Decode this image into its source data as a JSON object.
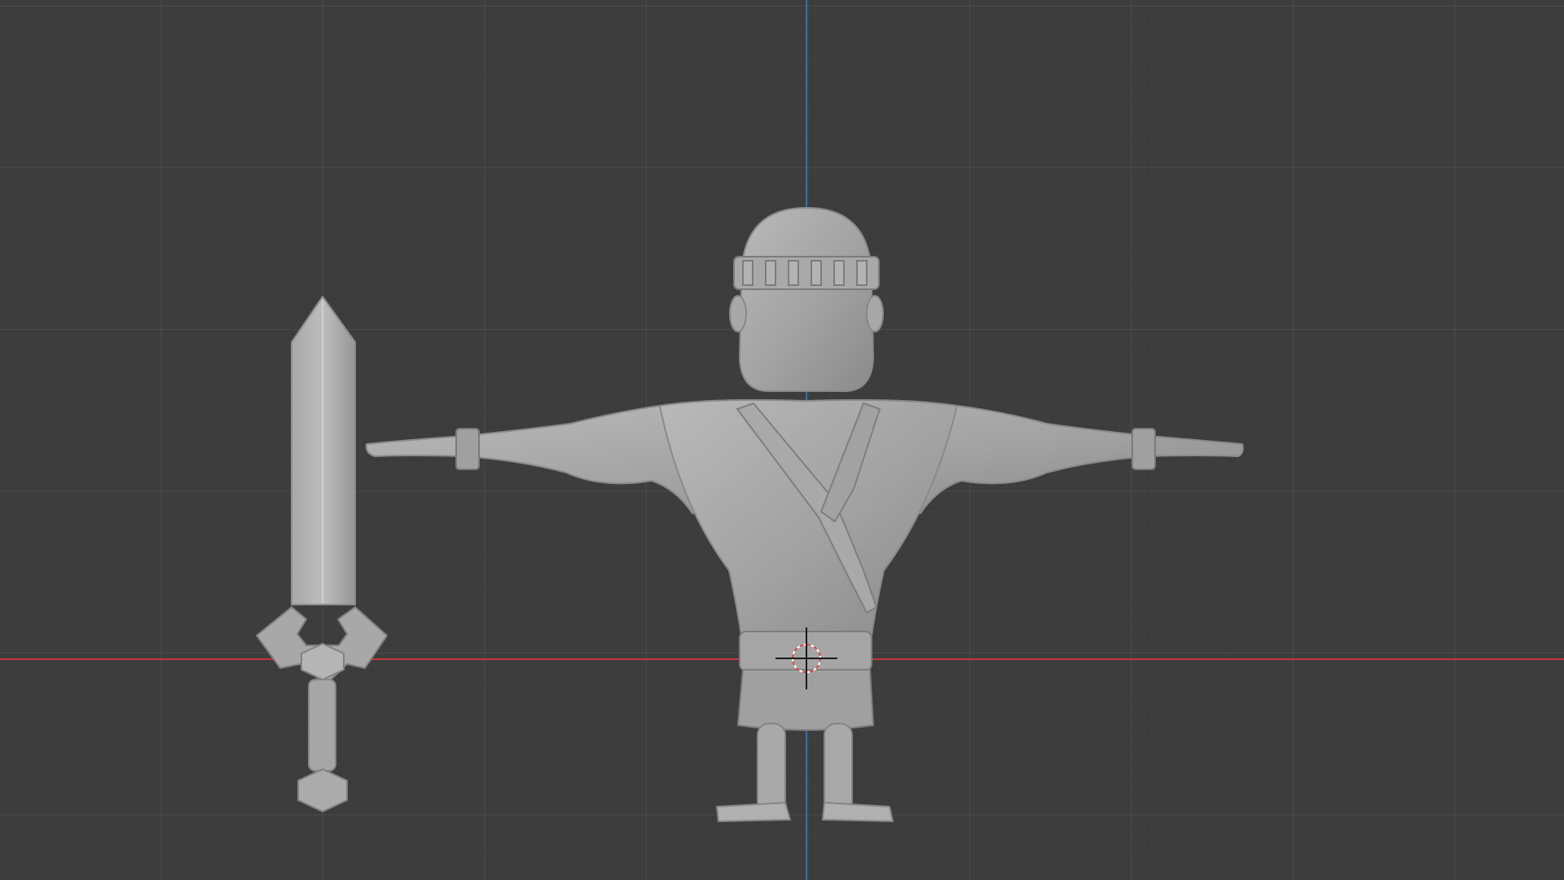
{
  "viewport": {
    "view": "back-orthographic",
    "background_color": "#3d3d3d",
    "grid_line_color": "#4a4a4a",
    "axis_x_color": "#c4333f",
    "axis_z_color": "#2f6fb8",
    "objects": [
      {
        "name": "sword",
        "icon": "sword-mesh-icon"
      },
      {
        "name": "character",
        "icon": "humanoid-mesh-icon"
      }
    ],
    "cursor_3d": {
      "icon": "crosshair-icon",
      "colors": [
        "#e0453f",
        "#ffffff"
      ]
    }
  }
}
